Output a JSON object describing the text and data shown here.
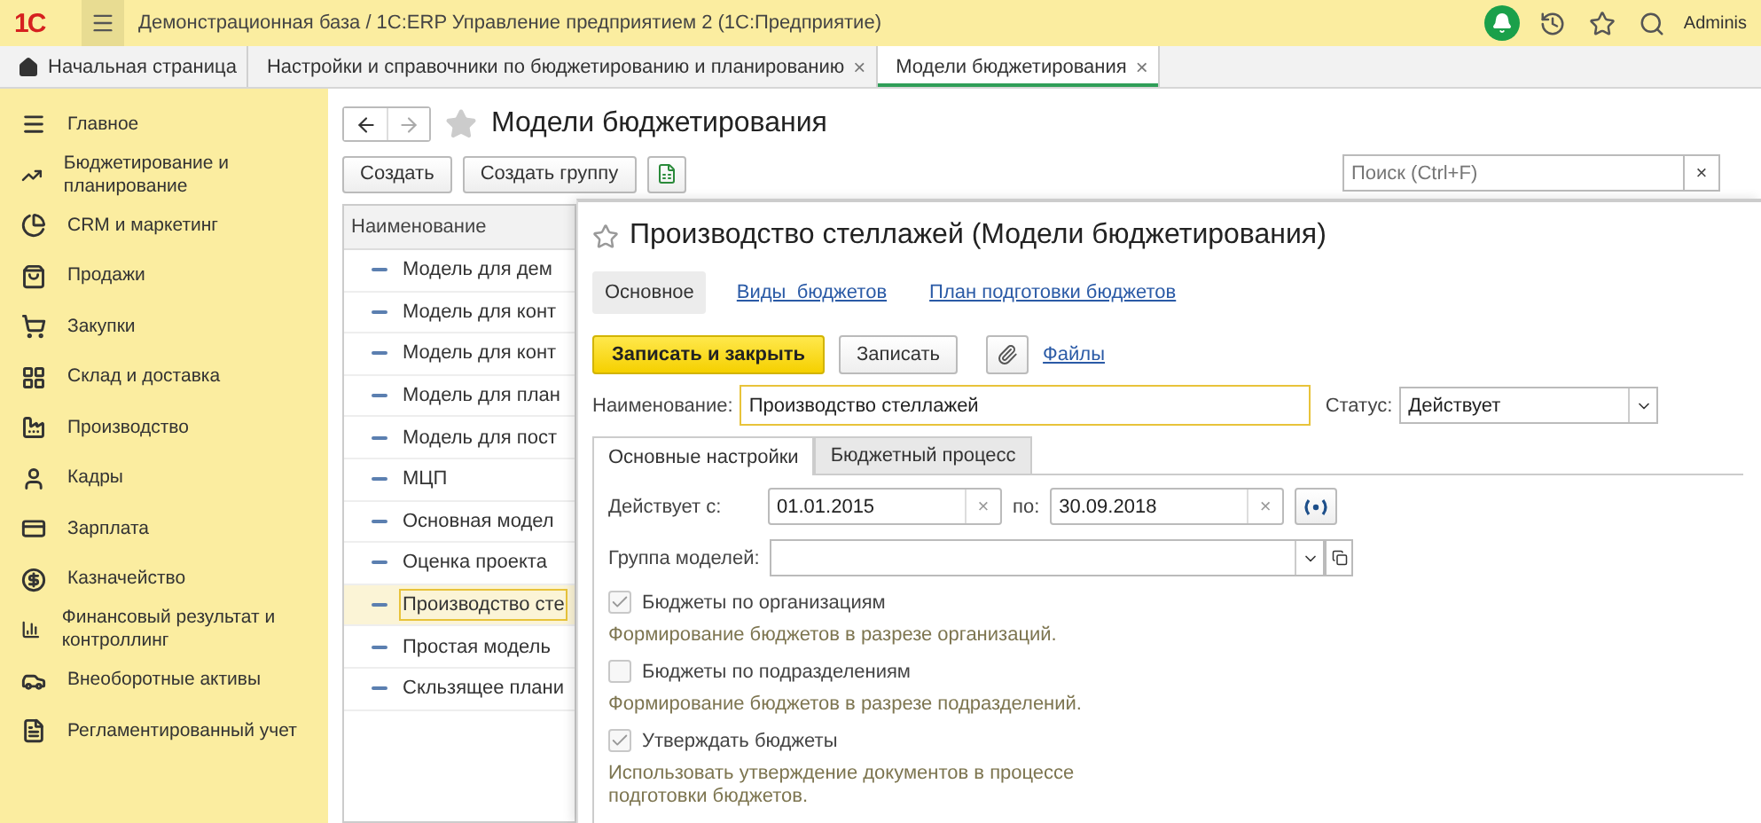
{
  "app": {
    "logo": "1С",
    "title": "Демонстрационная база / 1С:ERP Управление предприятием 2  (1С:Предприятие)",
    "user": "Adminis"
  },
  "clear_mark": "×",
  "tabs": [
    {
      "label": "Начальная страница",
      "kind": "home",
      "selected": false
    },
    {
      "label": "Настройки и справочники по бюджетированию и планированию",
      "kind": "page",
      "selected": false
    },
    {
      "label": "Модели бюджетирования",
      "kind": "page",
      "selected": true
    }
  ],
  "sidebar": [
    {
      "label": "Главное"
    },
    {
      "label": "Бюджетирование и планирование"
    },
    {
      "label": "CRM и маркетинг"
    },
    {
      "label": "Продажи"
    },
    {
      "label": "Закупки"
    },
    {
      "label": "Склад и доставка"
    },
    {
      "label": "Производство"
    },
    {
      "label": "Кадры"
    },
    {
      "label": "Зарплата"
    },
    {
      "label": "Казначейство"
    },
    {
      "label": "Финансовый результат и контроллинг"
    },
    {
      "label": "Внеоборотные активы"
    },
    {
      "label": "Регламентированный учет"
    }
  ],
  "list": {
    "title": "Модели бюджетирования",
    "buttons": [
      "Создать",
      "Создать группу"
    ],
    "search": {
      "placeholder": "Поиск (Ctrl+F)"
    },
    "column": "Наименование",
    "rows": [
      {
        "name": "Модель для дем",
        "selected": false
      },
      {
        "name": "Модель для конт",
        "selected": false
      },
      {
        "name": "Модель для конт",
        "selected": false
      },
      {
        "name": "Модель для план",
        "selected": false
      },
      {
        "name": "Модель для пост",
        "selected": false
      },
      {
        "name": "МЦП",
        "selected": false
      },
      {
        "name": "Основная модел",
        "selected": false
      },
      {
        "name": "Оценка проекта",
        "selected": false
      },
      {
        "name": "Производство сте",
        "selected": true
      },
      {
        "name": "Простая модель",
        "selected": false
      },
      {
        "name": "Скльзящее плани",
        "selected": false
      }
    ]
  },
  "form": {
    "title": "Производство стеллажей (Модели бюджетирования)",
    "nav": [
      {
        "label": "Основное",
        "selected": true
      },
      {
        "label": "Виды  бюджетов",
        "selected": false
      },
      {
        "label": "План подготовки бюджетов",
        "selected": false
      }
    ],
    "commands": {
      "primary": "Записать и закрыть",
      "save": "Записать",
      "files": "Файлы"
    },
    "name": {
      "label": "Наименование:",
      "value": "Производство стеллажей"
    },
    "status": {
      "label": "Статус:",
      "value": "Действует"
    },
    "tabs": [
      {
        "label": "Основные настройки",
        "selected": true
      },
      {
        "label": "Бюджетный процесс",
        "selected": false
      }
    ],
    "valid_from": {
      "label": "Действует с:",
      "value": "01.01.2015"
    },
    "valid_to": {
      "label": "по:",
      "value": "30.09.2018"
    },
    "group": {
      "label": "Группа моделей:"
    },
    "options": [
      {
        "label": "Бюджеты по организациям",
        "checked": true,
        "hint": "Формирование бюджетов в разрезе организаций."
      },
      {
        "label": "Бюджеты по подразделениям",
        "checked": false,
        "hint": "Формирование бюджетов в разрезе подразделений."
      },
      {
        "label": "Утверждать бюджеты",
        "checked": true,
        "hint": "Использовать утверждение документов в процессе подготовки бюджетов."
      }
    ]
  }
}
